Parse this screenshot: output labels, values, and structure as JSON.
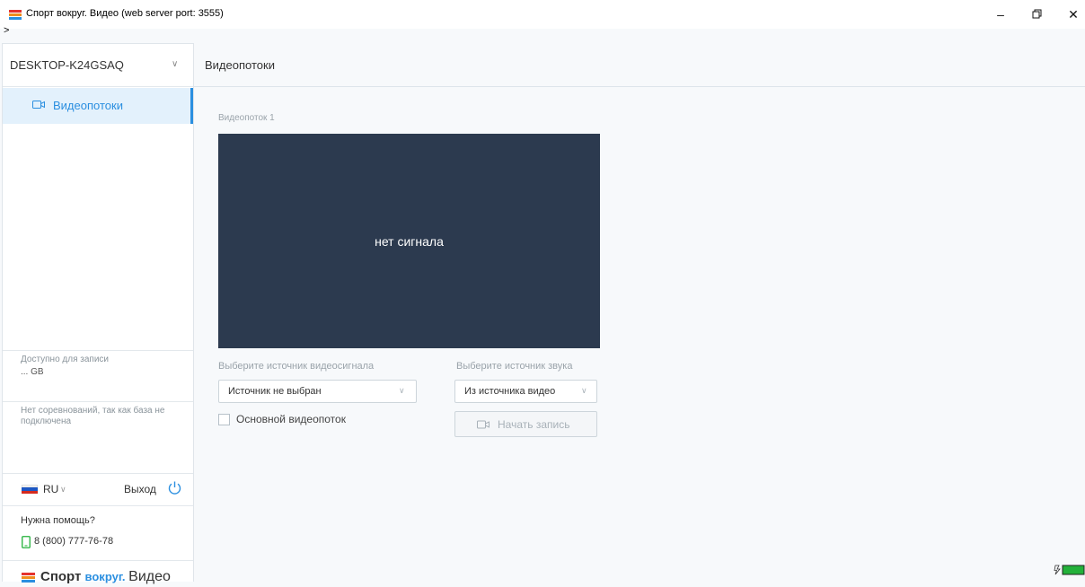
{
  "window": {
    "title": "Спорт вокруг. Видео (web server port: 3555)",
    "prompt": ">",
    "controls": [
      "minimize",
      "maximize",
      "close"
    ]
  },
  "sidebar": {
    "device": "DESKTOP-K24GSAQ",
    "nav": [
      {
        "label": "Видеопотоки",
        "icon": "camera-icon",
        "active": true
      }
    ],
    "storage": {
      "label": "Доступно для записи",
      "value": "... GB"
    },
    "db_status": "Нет соревнований, так как база не подключена",
    "language": "RU",
    "logout": "Выход",
    "help": {
      "title": "Нужна помощь?",
      "phone": "8 (800) 777-76-78"
    },
    "brand": {
      "part1": "Спорт ",
      "part2": "вокруг. ",
      "part3": "Видео"
    }
  },
  "header": {
    "title": "Видеопотоки"
  },
  "stream": {
    "label": "Видеопоток 1",
    "no_signal": "нет сигнала",
    "video_source_label": "Выберите источник видеосигнала",
    "video_source_value": "Источник не выбран",
    "audio_source_label": "Выберите источник звука",
    "audio_source_value": "Из источника видео",
    "main_stream_label": "Основной видеопоток",
    "main_stream_checked": false,
    "record_button": "Начать запись"
  },
  "colors": {
    "accent": "#2b8fe0",
    "video_bg": "#2c3a4f",
    "nav_active_bg": "#e3f1fc",
    "logo_red": "#e5322d",
    "logo_blue": "#2b8fe0",
    "battery": "#23b13a"
  }
}
